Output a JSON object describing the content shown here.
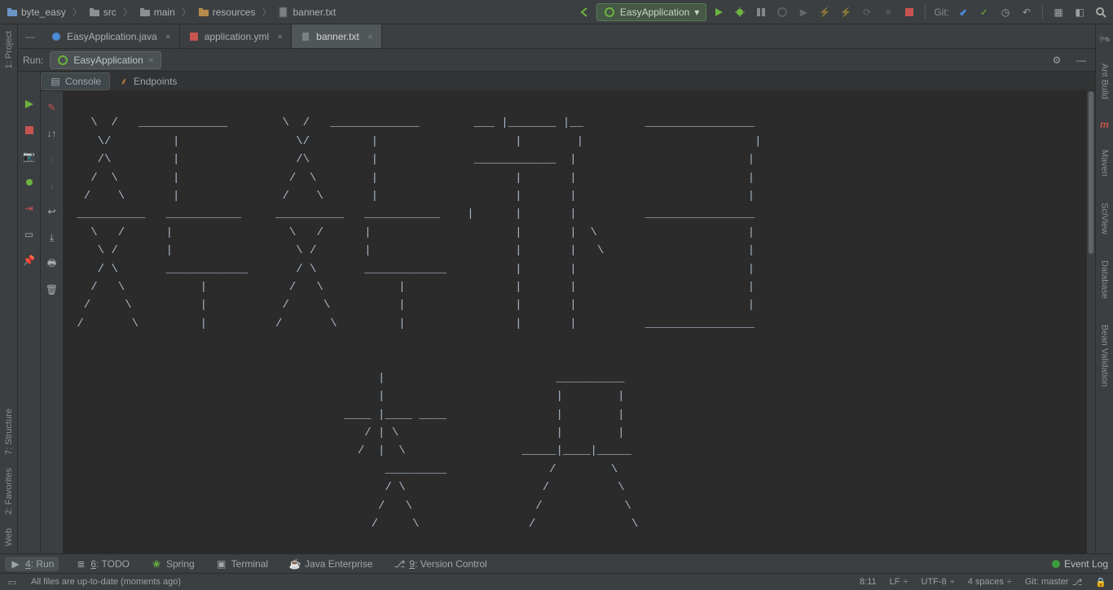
{
  "breadcrumbs": {
    "project": "byte_easy",
    "src": "src",
    "main": "main",
    "resources": "resources",
    "file": "banner.txt"
  },
  "run_config": {
    "selected": "EasyApplication"
  },
  "git": {
    "label": "Git:"
  },
  "editor_tabs": {
    "t0": {
      "label": "EasyApplication.java"
    },
    "t1": {
      "label": "application.yml"
    },
    "t2": {
      "label": "banner.txt"
    }
  },
  "run_panel": {
    "title": "Run:",
    "tab_name": "EasyApplication",
    "subtab_console": "Console",
    "subtab_endpoints": "Endpoints"
  },
  "left_strip": {
    "project": "1: Project"
  },
  "right_strip": {
    "ant": "Ant Build",
    "maven": "Maven",
    "sciview": "SciView",
    "database": "Database",
    "bean": "Bean Validation"
  },
  "bottom": {
    "run": "4: Run",
    "todo": "6: TODO",
    "spring": "Spring",
    "terminal": "Terminal",
    "java_ee": "Java Enterprise",
    "vcs": "9: Version Control",
    "event_log": "Event Log"
  },
  "status": {
    "message": "All files are up-to-date (moments ago)",
    "pos": "8:11",
    "le": "LF",
    "enc": "UTF-8",
    "indent": "4 spaces",
    "branch": "Git: master"
  },
  "console_lines": [
    "",
    "   \\  /   _____________        \\  /   _____________        ___ |_______ |__         ________________",
    "    \\/         |                 \\/         |                    |        |                         |",
    "    /\\         |                 /\\         |              ____________  |                         |",
    "   /  \\        |                /  \\        |                    |       |                         |",
    "  /    \\       |               /    \\       |                    |       |                         |",
    " __________   ___________     __________   ___________    |      |       |          ________________",
    "   \\   /      |                 \\   /      |                     |       |  \\                      |",
    "    \\ /       |                  \\ /       |                     |       |   \\                     |",
    "    / \\       ____________       / \\       ____________          |       |                         |",
    "   /   \\           |            /   \\           |                |       |                         |",
    "  /     \\          |           /     \\          |                |       |                         |",
    " /       \\         |          /       \\         |                |       |          ________________",
    "",
    "",
    "                                             |                         __________",
    "                                             |                         |        |",
    "                                        ____ |____ ____                |        |",
    "                                           / | \\                       |        |",
    "                                          /  |  \\                 _____|____|_____",
    "                                              _________               /        \\",
    "                                              / \\                    /          \\",
    "                                             /   \\                  /            \\",
    "                                            /     \\                /              \\"
  ]
}
